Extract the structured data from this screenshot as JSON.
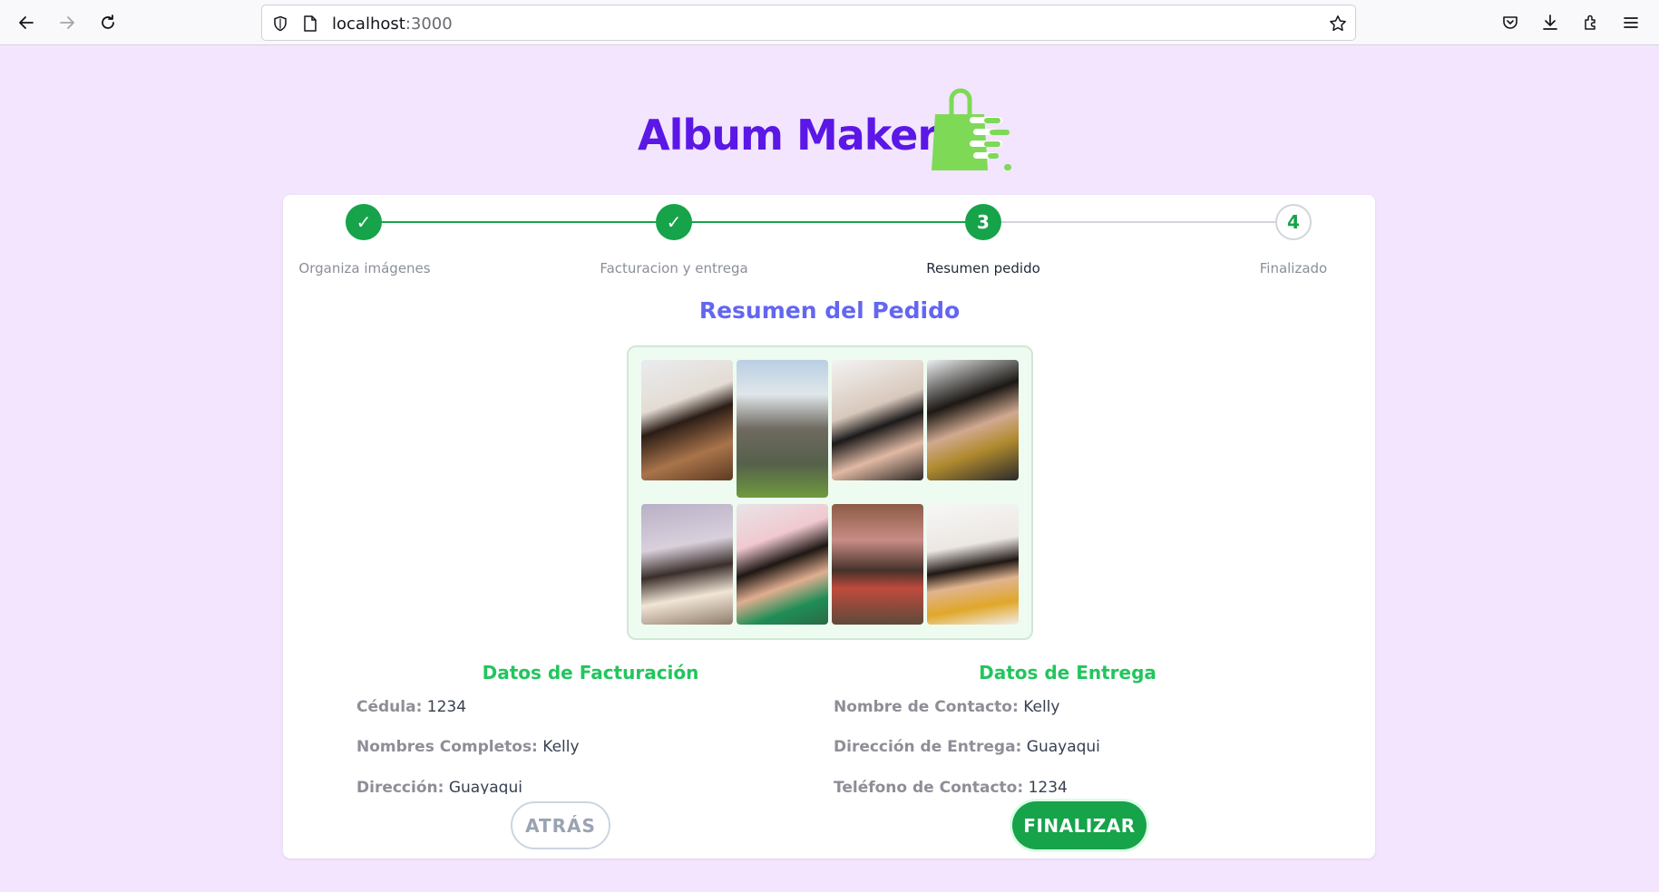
{
  "browser": {
    "url_host": "localhost",
    "url_port": ":3000"
  },
  "app": {
    "logo_text": "Album Maker"
  },
  "stepper": {
    "steps": [
      {
        "label": "Organiza imágenes",
        "marker": "✓",
        "state": "done"
      },
      {
        "label": "Facturacion y entrega",
        "marker": "✓",
        "state": "done"
      },
      {
        "label": "Resumen pedido",
        "marker": "3",
        "state": "active"
      },
      {
        "label": "Finalizado",
        "marker": "4",
        "state": "todo"
      }
    ]
  },
  "summary": {
    "title": "Resumen del Pedido"
  },
  "billing": {
    "title": "Datos de Facturación",
    "fields": [
      {
        "label": "Cédula:",
        "value": "1234"
      },
      {
        "label": "Nombres Completos:",
        "value": "Kelly"
      },
      {
        "label": "Dirección:",
        "value": "Guayaqui"
      }
    ]
  },
  "delivery": {
    "title": "Datos de Entrega",
    "fields": [
      {
        "label": "Nombre de Contacto:",
        "value": "Kelly"
      },
      {
        "label": "Dirección de Entrega:",
        "value": "Guayaqui"
      },
      {
        "label": "Teléfono de Contacto:",
        "value": "1234"
      }
    ]
  },
  "actions": {
    "back_label": "ATRÁS",
    "finish_label": "FINALIZAR"
  },
  "colors": {
    "page_bg": "#f2e5fd",
    "brand_purple": "#5b17e6",
    "brand_green": "#7ed957",
    "step_green": "#16a34a",
    "title_indigo": "#6366f1",
    "section_green": "#22c55e"
  }
}
